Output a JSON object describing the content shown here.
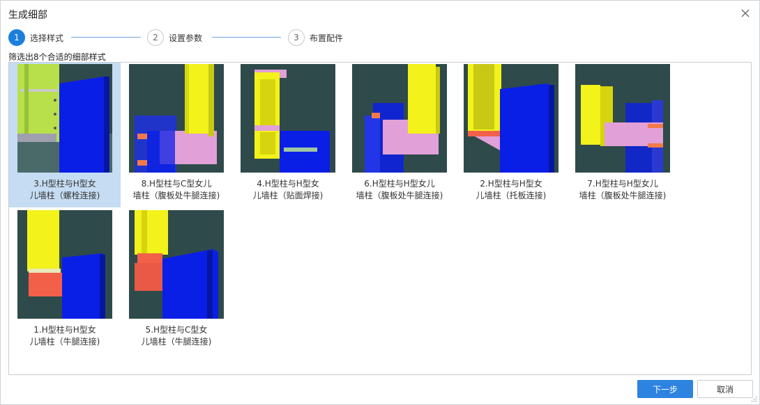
{
  "dialog": {
    "title": "生成细部",
    "close_icon": "close-icon"
  },
  "steps": [
    {
      "number": "1",
      "label": "选择样式",
      "active": true
    },
    {
      "number": "2",
      "label": "设置参数",
      "active": false
    },
    {
      "number": "3",
      "label": "布置配件",
      "active": false
    }
  ],
  "filter_text": "筛选出8个合适的细部样式",
  "styles": [
    {
      "caption": "3.H型柱与H型女\n儿墙柱（螺栓连接)",
      "selected": true,
      "thumbnail": "bolted-connection-thumbnail"
    },
    {
      "caption": "8.H型柱与C型女儿\n墙柱（腹板处牛腿连接)",
      "selected": false,
      "thumbnail": "web-bracket-c-thumbnail"
    },
    {
      "caption": "4.H型柱与H型女\n儿墙柱（贴面焊接)",
      "selected": false,
      "thumbnail": "face-weld-thumbnail"
    },
    {
      "caption": "6.H型柱与H型女儿\n墙柱（腹板处牛腿连接)",
      "selected": false,
      "thumbnail": "web-bracket-h-thumbnail"
    },
    {
      "caption": "2.H型柱与H型女\n儿墙柱（托板连接)",
      "selected": false,
      "thumbnail": "support-plate-thumbnail"
    },
    {
      "caption": "7.H型柱与H型女儿\n墙柱（腹板处牛腿连接)",
      "selected": false,
      "thumbnail": "web-bracket-h2-thumbnail"
    },
    {
      "caption": "1.H型柱与H型女\n儿墙柱（牛腿连接)",
      "selected": false,
      "thumbnail": "bracket-h-thumbnail"
    },
    {
      "caption": "5.H型柱与C型女\n儿墙柱（牛腿连接)",
      "selected": false,
      "thumbnail": "bracket-c-thumbnail"
    }
  ],
  "buttons": {
    "next": "下一步",
    "cancel": "取消"
  },
  "colors": {
    "accent": "#2d83e0",
    "selected_bg": "#c5dcf3",
    "thumbnail_bg": "#2f4a4a",
    "column_blue": "#0a1fe6",
    "parapet_yellow": "#f3f21a",
    "plate_pink": "#e2a0d8",
    "bracket_red": "#f2604a"
  }
}
